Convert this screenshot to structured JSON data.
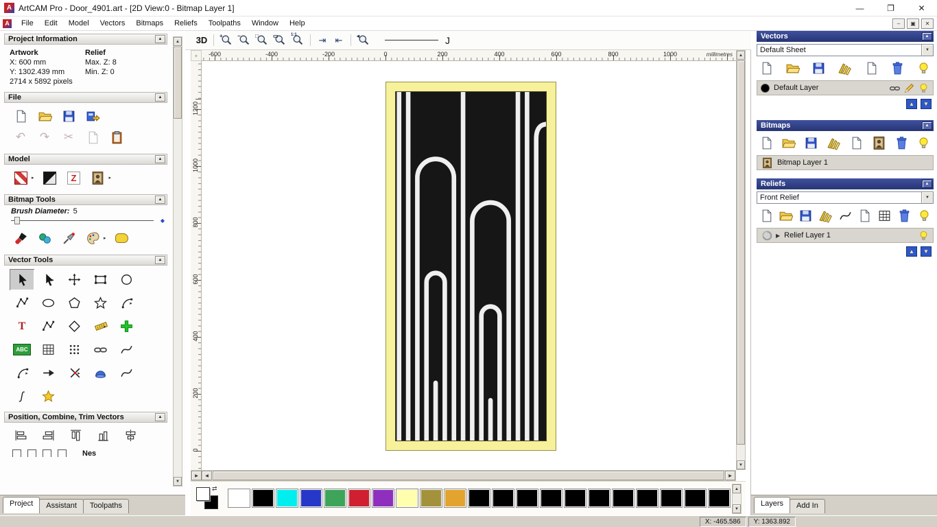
{
  "window": {
    "title": "ArtCAM Pro - Door_4901.art - [2D View:0 - Bitmap Layer 1]"
  },
  "menu": {
    "items": [
      "File",
      "Edit",
      "Model",
      "Vectors",
      "Bitmaps",
      "Reliefs",
      "Toolpaths",
      "Window",
      "Help"
    ]
  },
  "left_panel": {
    "project_information": {
      "header": "Project Information",
      "artwork_label": "Artwork",
      "relief_label": "Relief",
      "artwork_x": "X: 600 mm",
      "artwork_y": "Y: 1302.439 mm",
      "artwork_pixels": "2714 x 5892 pixels",
      "relief_max_z": "Max. Z: 8",
      "relief_min_z": "Min. Z: 0"
    },
    "file_section": {
      "header": "File"
    },
    "model_section": {
      "header": "Model"
    },
    "bitmap_tools": {
      "header": "Bitmap Tools",
      "brush_diameter_label": "Brush Diameter:",
      "brush_diameter_value": "5"
    },
    "vector_tools": {
      "header": "Vector Tools",
      "text_tool_label": "T",
      "abc_tool_label": "ABC",
      "profile_tool_label": "ʃ"
    },
    "position_section": {
      "header": "Position, Combine, Trim Vectors",
      "clipped_label": "Nes"
    },
    "tabs": {
      "items": [
        "Project",
        "Assistant",
        "Toolpaths"
      ],
      "active": "Project"
    }
  },
  "toolbar": {
    "view_3d": "3D",
    "line_style_preview": "J"
  },
  "rulers": {
    "horizontal": [
      "-600",
      "-400",
      "-200",
      "0",
      "200",
      "400",
      "600",
      "800",
      "1000"
    ],
    "vertical": [
      "1200",
      "1000",
      "800",
      "600",
      "400",
      "200",
      "0"
    ],
    "unit": "millimetres"
  },
  "palette": {
    "foreground": "#ffffff",
    "background": "#000000",
    "colors": [
      "#ffffff",
      "#000000",
      "#00eeee",
      "#2737c8",
      "#3da45a",
      "#d01f30",
      "#8e2fbe",
      "#ffffae",
      "#a3923b",
      "#e2a42e",
      "#000000",
      "#000000",
      "#000000",
      "#000000",
      "#000000",
      "#000000",
      "#000000",
      "#000000",
      "#000000",
      "#000000",
      "#000000"
    ]
  },
  "right_panel": {
    "vectors": {
      "header": "Vectors",
      "sheet": "Default Sheet",
      "layer": "Default Layer"
    },
    "bitmaps": {
      "header": "Bitmaps",
      "layer": "Bitmap Layer 1"
    },
    "reliefs": {
      "header": "Reliefs",
      "relief": "Front Relief",
      "layer": "Relief Layer 1"
    },
    "tabs": {
      "items": [
        "Layers",
        "Add In"
      ],
      "active": "Layers"
    }
  },
  "status_bar": {
    "x": "X: -465.586",
    "y": "Y: 1363.892"
  }
}
